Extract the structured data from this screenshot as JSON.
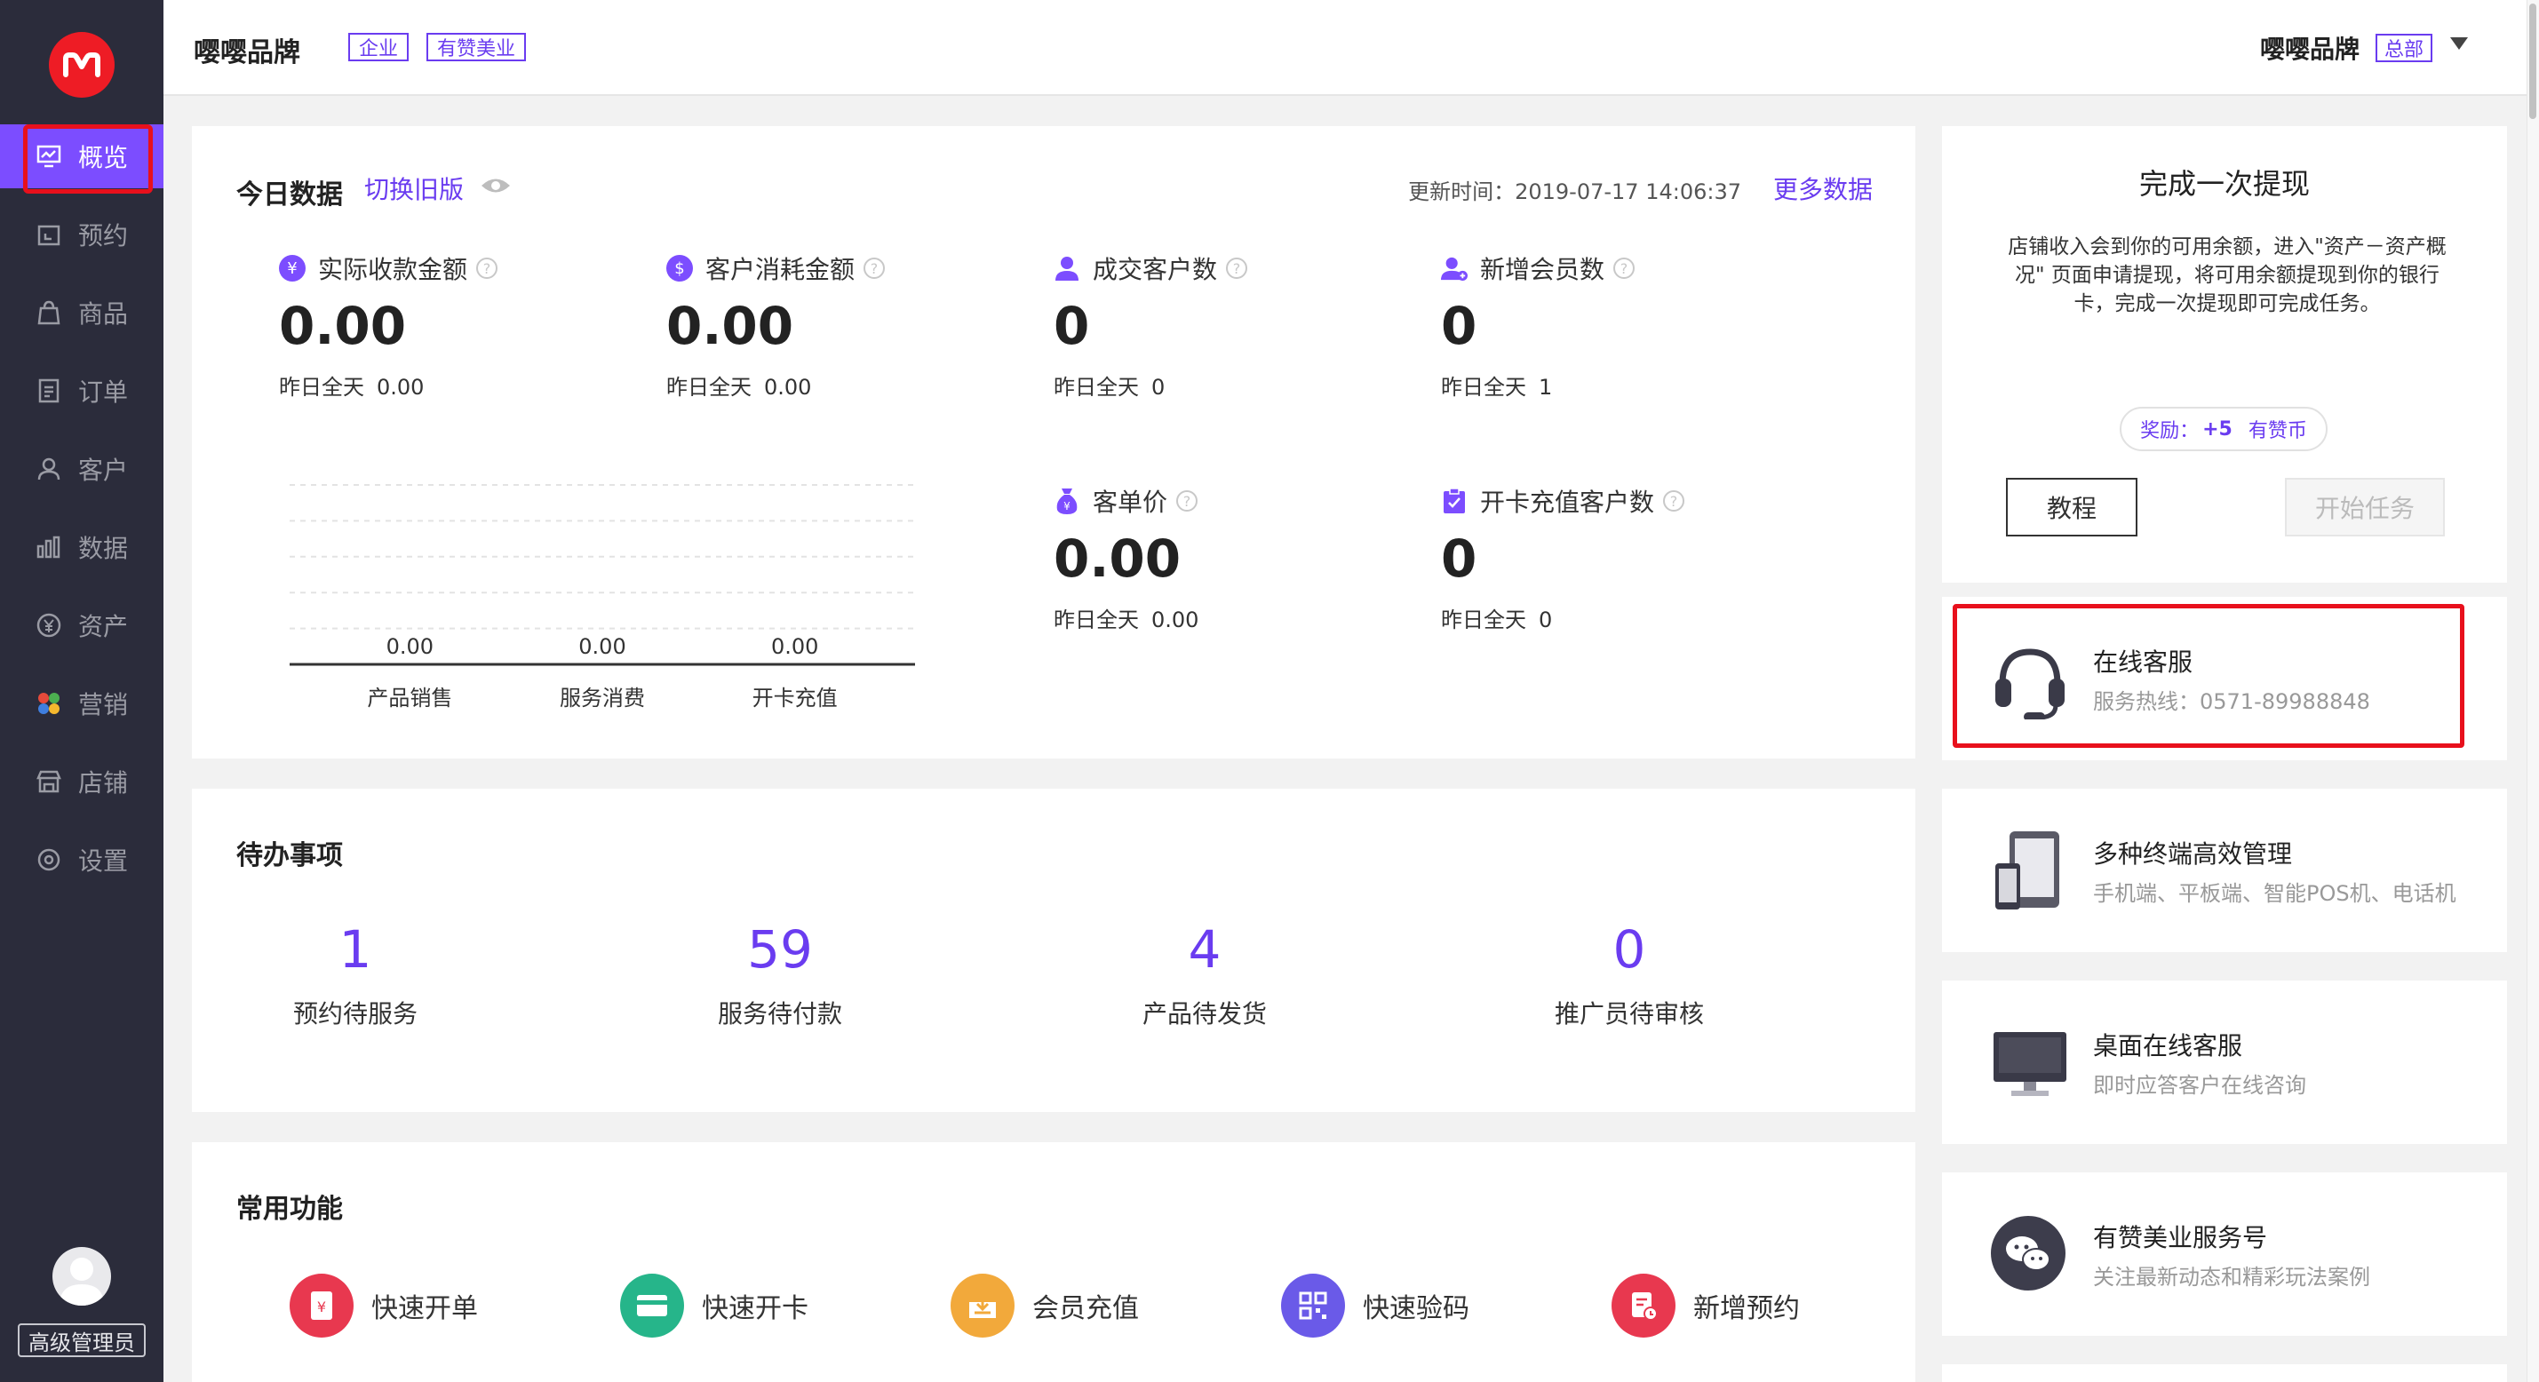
{
  "sidebar": {
    "items": [
      {
        "label": "概览",
        "icon": "dashboard-icon"
      },
      {
        "label": "预约",
        "icon": "calendar-icon"
      },
      {
        "label": "商品",
        "icon": "bag-icon"
      },
      {
        "label": "订单",
        "icon": "order-icon"
      },
      {
        "label": "客户",
        "icon": "user-icon"
      },
      {
        "label": "数据",
        "icon": "bar-chart-icon"
      },
      {
        "label": "资产",
        "icon": "yen-icon"
      },
      {
        "label": "营销",
        "icon": "marketing-icon"
      },
      {
        "label": "店铺",
        "icon": "store-icon"
      },
      {
        "label": "设置",
        "icon": "settings-icon"
      }
    ],
    "role": "高级管理员"
  },
  "header": {
    "brand": "嘤嘤品牌",
    "tags": [
      "企业",
      "有赞美业"
    ],
    "account_name": "嘤嘤品牌",
    "account_tag": "总部"
  },
  "today": {
    "title": "今日数据",
    "switch_link": "切换旧版",
    "update_label": "更新时间：2019-07-17 14:06:37",
    "more_link": "更多数据",
    "stats": [
      {
        "label": "实际收款金额",
        "icon": "yen-circle-icon",
        "value": "0.00",
        "sub_label": "昨日全天",
        "sub_value": "0.00"
      },
      {
        "label": "客户消耗金额",
        "icon": "dollar-circle-icon",
        "value": "0.00",
        "sub_label": "昨日全天",
        "sub_value": "0.00"
      },
      {
        "label": "成交客户数",
        "icon": "person-icon",
        "value": "0",
        "sub_label": "昨日全天",
        "sub_value": "0"
      },
      {
        "label": "新增会员数",
        "icon": "person-add-icon",
        "value": "0",
        "sub_label": "昨日全天",
        "sub_value": "1"
      },
      {
        "label": "客单价",
        "icon": "money-bag-icon",
        "value": "0.00",
        "sub_label": "昨日全天",
        "sub_value": "0.00"
      },
      {
        "label": "开卡充值客户数",
        "icon": "clipboard-check-icon",
        "value": "0",
        "sub_label": "昨日全天",
        "sub_value": "0"
      }
    ]
  },
  "chart_data": {
    "type": "bar",
    "categories": [
      "产品销售",
      "服务消费",
      "开卡充值"
    ],
    "values": [
      0.0,
      0.0,
      0.0
    ],
    "value_labels": [
      "0.00",
      "0.00",
      "0.00"
    ],
    "title": "",
    "xlabel": "",
    "ylabel": "",
    "grid": true
  },
  "todo": {
    "title": "待办事项",
    "items": [
      {
        "count": "1",
        "label": "预约待服务"
      },
      {
        "count": "59",
        "label": "服务待付款"
      },
      {
        "count": "4",
        "label": "产品待发货"
      },
      {
        "count": "0",
        "label": "推广员待审核"
      }
    ]
  },
  "functions": {
    "title": "常用功能",
    "items": [
      {
        "label": "快速开单",
        "icon": "quick-order-icon",
        "color": "#e8384f"
      },
      {
        "label": "快速开卡",
        "icon": "card-icon",
        "color": "#26b58a"
      },
      {
        "label": "会员充值",
        "icon": "recharge-icon",
        "color": "#f2a93b"
      },
      {
        "label": "快速验码",
        "icon": "qrcode-icon",
        "color": "#6a5ae8"
      },
      {
        "label": "新增预约",
        "icon": "appointment-icon",
        "color": "#e8384f"
      }
    ]
  },
  "task": {
    "title": "完成一次提现",
    "desc": "店铺收入会到你的可用余额，进入\"资产－资产概况\" 页面申请提现，将可用余额提现到你的银行卡，完成一次提现即可完成任务。",
    "reward_label": "奖励：",
    "reward_value": "+5",
    "reward_unit": "有赞币",
    "tutorial_btn": "教程",
    "start_btn": "开始任务"
  },
  "service_cards": [
    {
      "title": "在线客服",
      "sub": "服务热线：0571-89988848",
      "icon": "headset-icon"
    },
    {
      "title": "多种终端高效管理",
      "sub": "手机端、平板端、智能POS机、电话机",
      "icon": "devices-icon"
    },
    {
      "title": "桌面在线客服",
      "sub": "即时应答客户在线咨询",
      "icon": "monitor-icon"
    },
    {
      "title": "有赞美业服务号",
      "sub": "关注最新动态和精彩玩法案例",
      "icon": "wechat-icon"
    }
  ],
  "colors": {
    "accent": "#6a3cf0",
    "sidebar_bg": "#2b2c3b",
    "active_nav": "#7c4dff",
    "highlight_box": "#e8101c"
  }
}
